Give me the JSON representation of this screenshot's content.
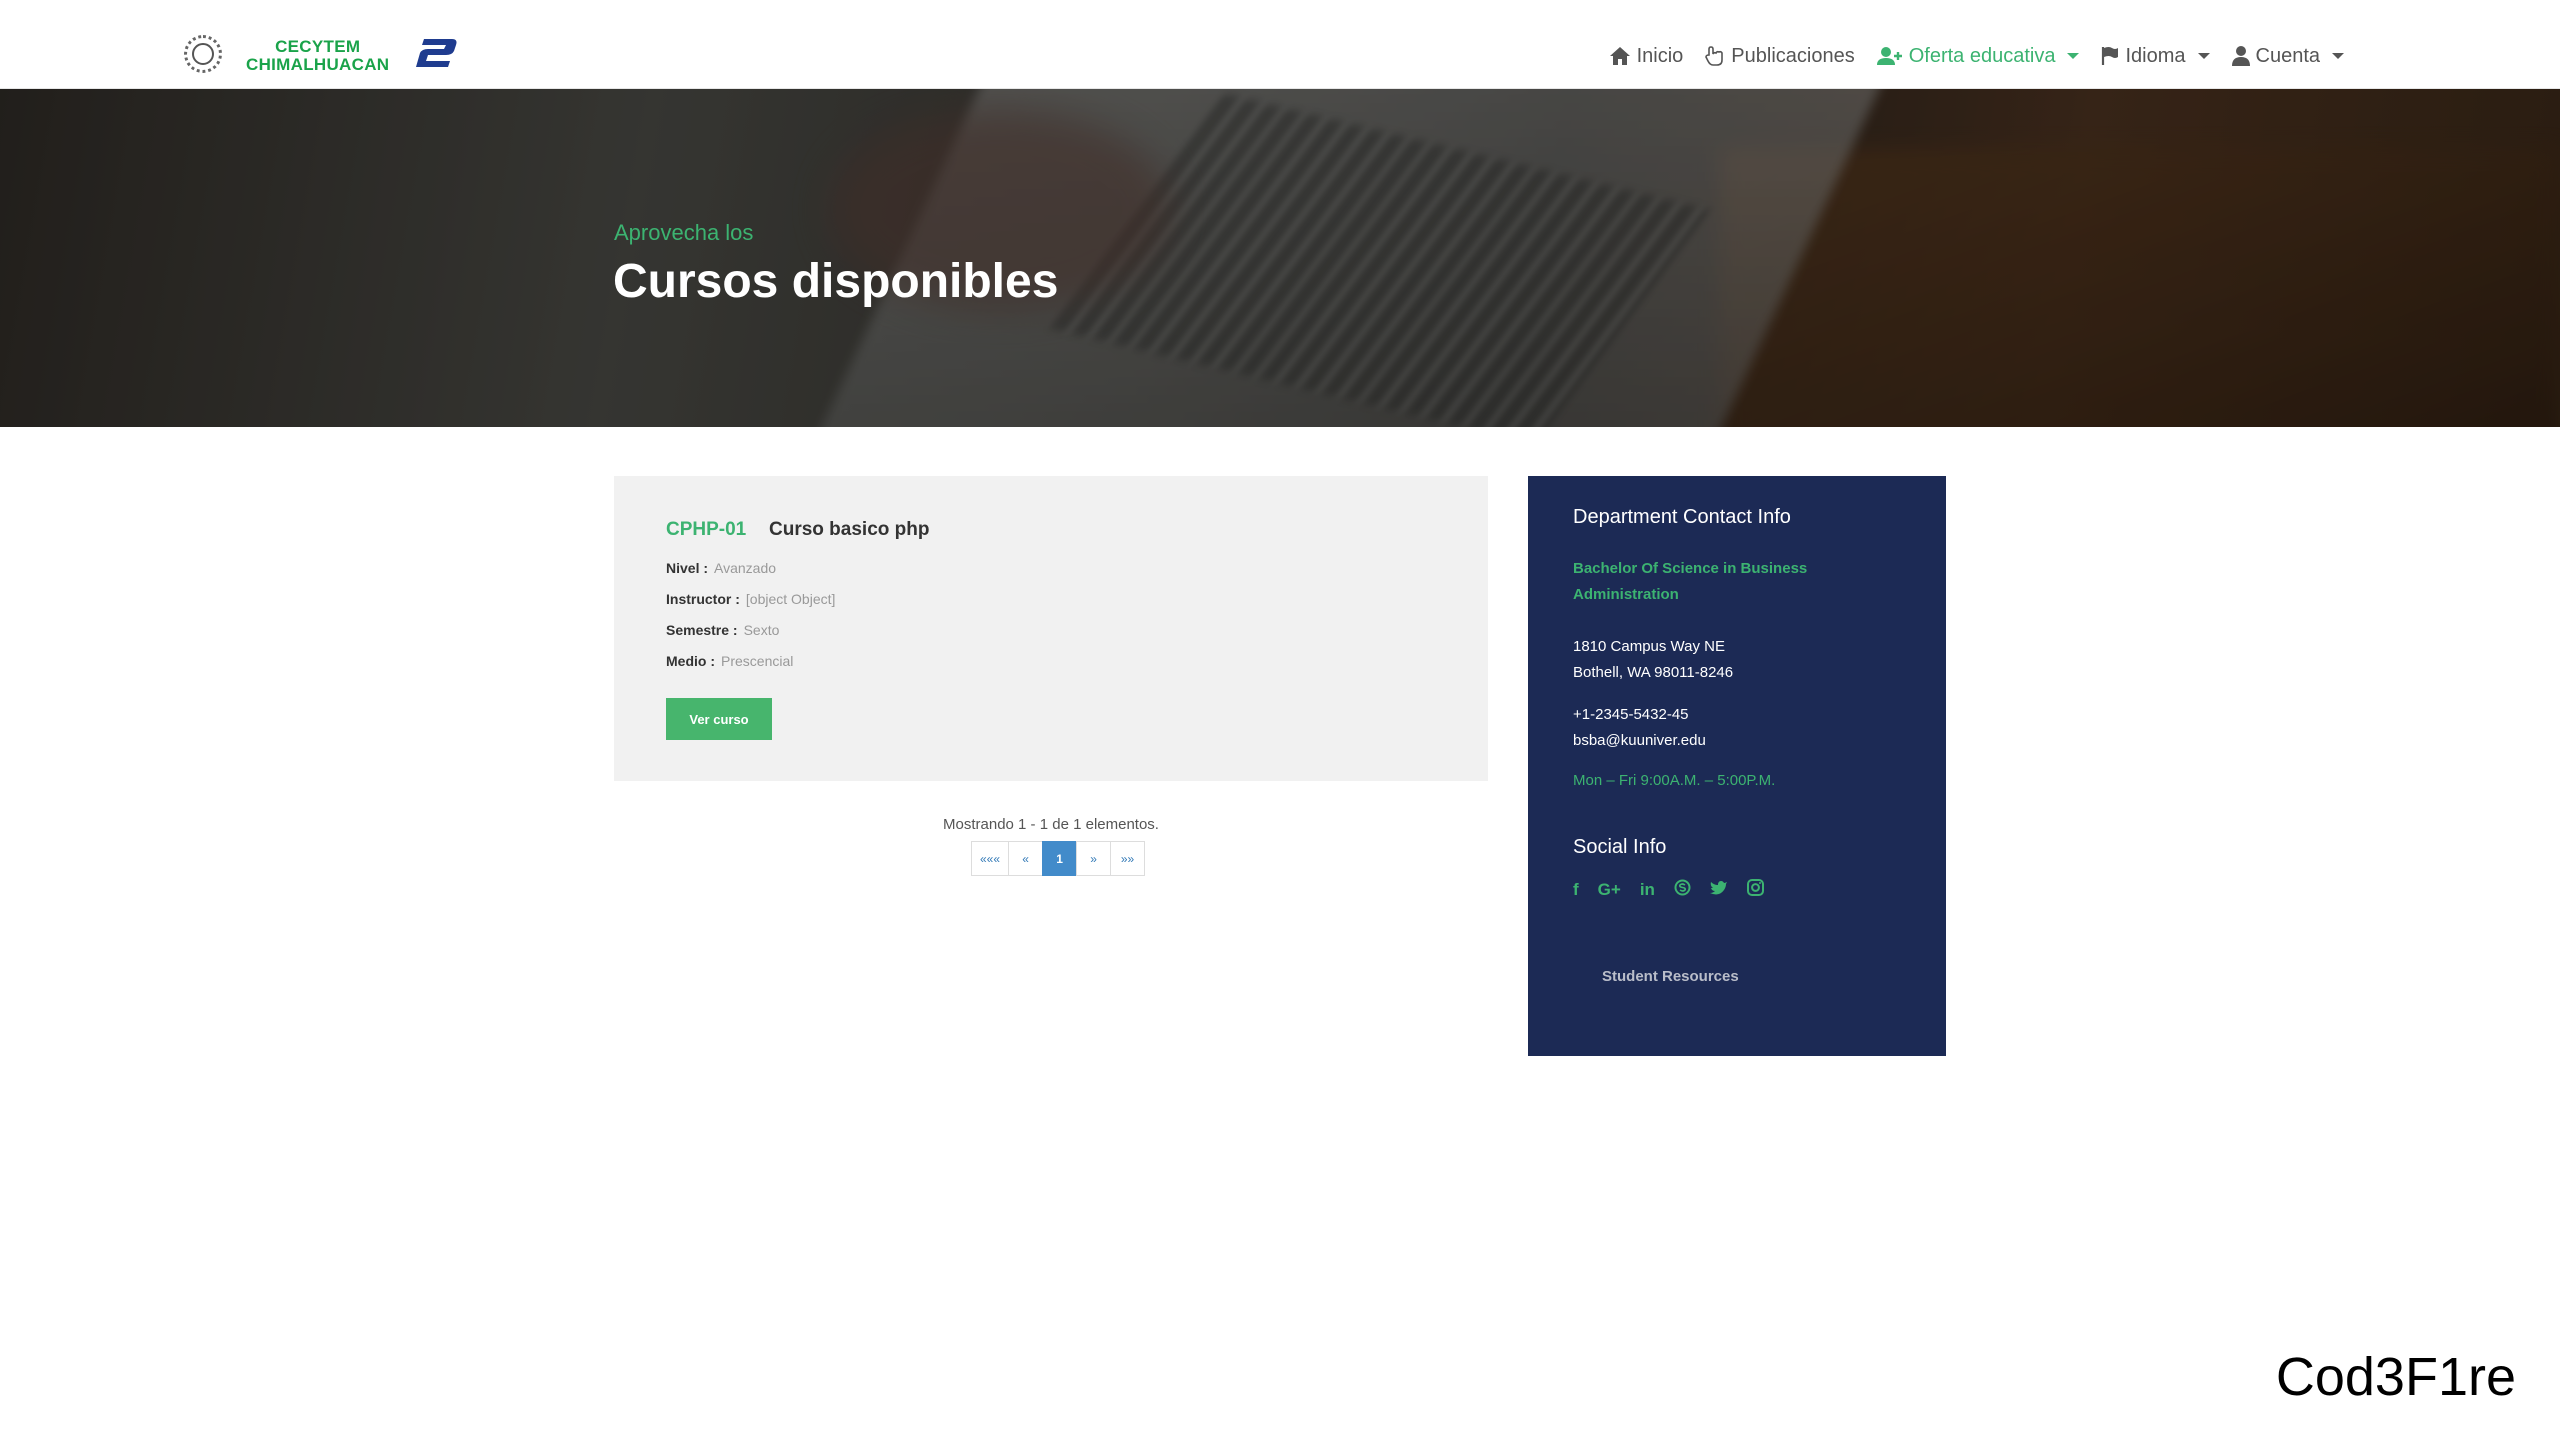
{
  "brand": {
    "line1": "CECYTEM",
    "line2": "CHIMALHUACAN",
    "mark": "2",
    "colors": {
      "green": "#1aa34a",
      "blue": "#1f3c8f"
    }
  },
  "nav": {
    "inicio": "Inicio",
    "publicaciones": "Publicaciones",
    "oferta": "Oferta educativa",
    "idioma": "Idioma",
    "cuenta": "Cuenta"
  },
  "hero": {
    "subtitle": "Aprovecha los",
    "title": "Cursos disponibles"
  },
  "course": {
    "code": "CPHP-01",
    "name": "Curso basico php",
    "fields": [
      {
        "label": "Nivel :",
        "value": "Avanzado"
      },
      {
        "label": "Instructor :",
        "value": "[object Object]"
      },
      {
        "label": "Semestre :",
        "value": "Sexto"
      },
      {
        "label": "Medio :",
        "value": "Prescencial"
      }
    ],
    "button": "Ver curso"
  },
  "pagination": {
    "summary": "Mostrando 1 - 1 de 1 elementos.",
    "first": "«««",
    "prev": "«",
    "current": "1",
    "next": "»",
    "last": "»»"
  },
  "sidebar": {
    "contact_title": "Department Contact Info",
    "program_line1": "Bachelor Of Science in Business",
    "program_line2": "Administration",
    "address_line1": "1810 Campus Way NE",
    "address_line2": "Bothell, WA 98011-8246",
    "phone": "+1-2345-5432-45",
    "email": "bsba@kuuniver.edu",
    "hours": "Mon – Fri 9:00A.M. – 5:00P.M.",
    "social_title": "Social Info",
    "social_icons": [
      "facebook-icon",
      "google-plus-icon",
      "linkedin-icon",
      "skype-icon",
      "twitter-icon",
      "instagram-icon"
    ],
    "resources": "Student Resources"
  },
  "watermark": "Cod3F1re"
}
